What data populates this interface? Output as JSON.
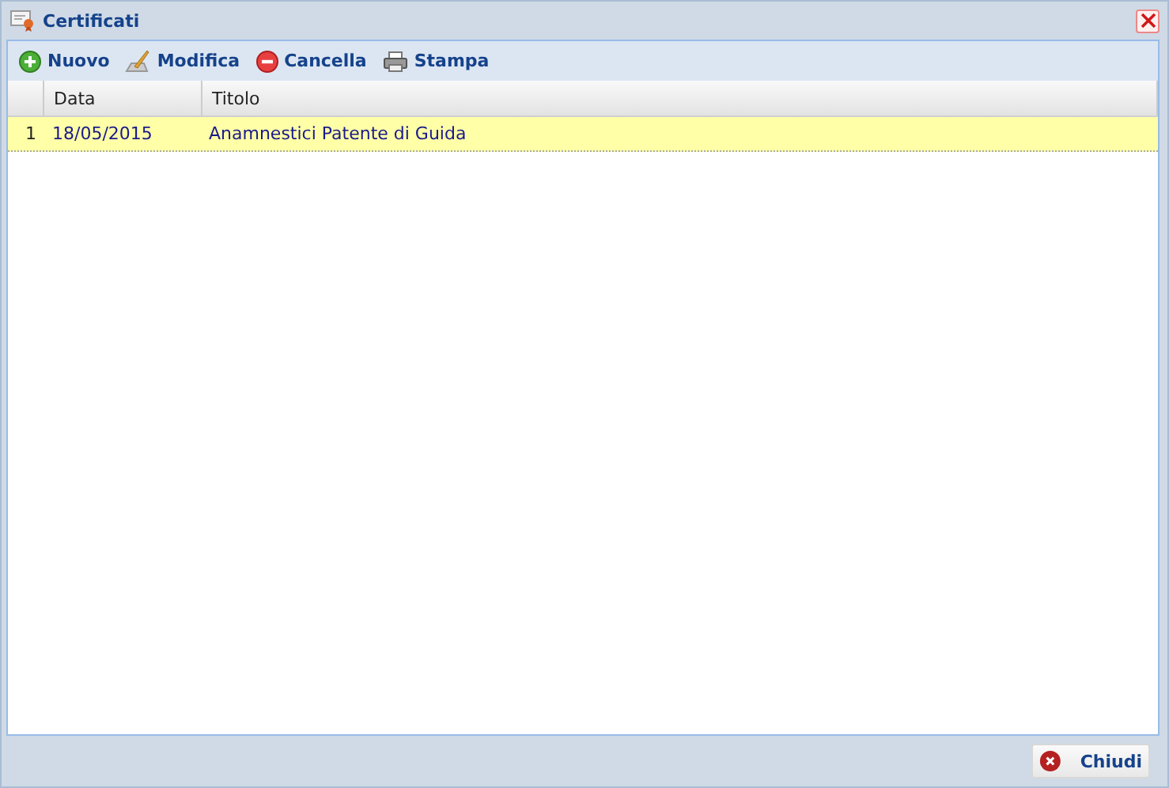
{
  "window": {
    "title": "Certificati"
  },
  "toolbar": [
    {
      "kind": "add",
      "label": "Nuovo"
    },
    {
      "kind": "edit",
      "label": "Modifica"
    },
    {
      "kind": "delete",
      "label": "Cancella"
    },
    {
      "kind": "print",
      "label": "Stampa"
    }
  ],
  "table": {
    "columns": [
      "Data",
      "Titolo"
    ],
    "rows": [
      {
        "number": "1",
        "cells": [
          "18/05/2015",
          "Anamnestici Patente di Guida"
        ],
        "selected": true
      }
    ]
  },
  "buttons": [
    {
      "kind": "close",
      "label": "Chiudi"
    }
  ]
}
